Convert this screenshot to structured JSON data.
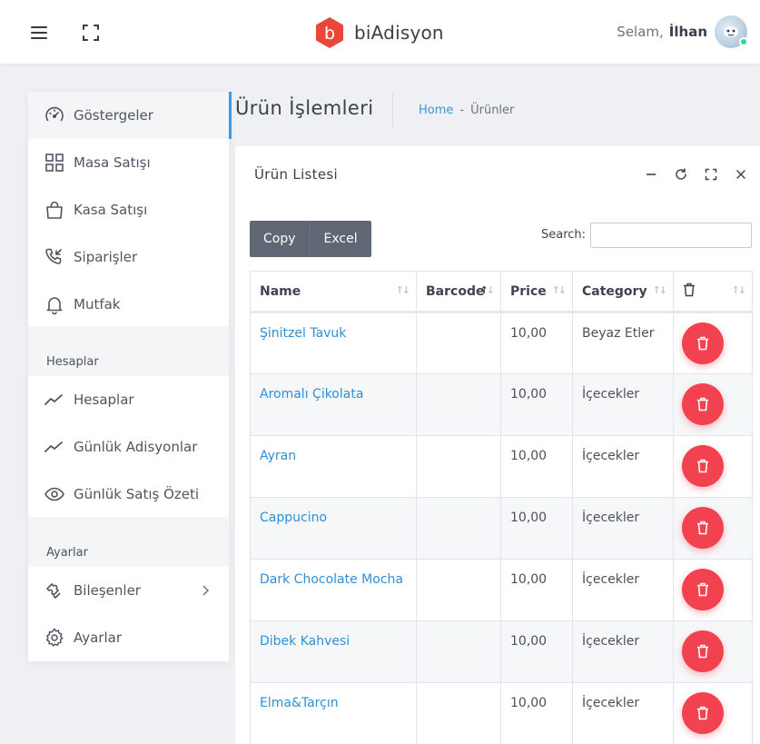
{
  "topbar": {
    "brand_letter": "b",
    "brand_name": "biAdisyon",
    "greeting": "Selam,",
    "username": "İlhan",
    "brand_color": "#e8473a"
  },
  "sidebar": {
    "items": [
      {
        "label": "Göstergeler",
        "icon": "speedometer-icon"
      },
      {
        "label": "Masa Satışı",
        "icon": "grid-icon"
      },
      {
        "label": "Kasa Satışı",
        "icon": "shopping-bag-icon"
      },
      {
        "label": "Siparişler",
        "icon": "phone-incoming-icon"
      },
      {
        "label": "Mutfak",
        "icon": "bell-icon"
      }
    ],
    "section_accounts": "Hesaplar",
    "accounts_items": [
      {
        "label": "Hesaplar",
        "icon": "trend-line-icon"
      },
      {
        "label": "Günlük Adisyonlar",
        "icon": "trend-line-icon"
      },
      {
        "label": "Günlük Satış Özeti",
        "icon": "eye-icon"
      }
    ],
    "section_settings": "Ayarlar",
    "settings_items": [
      {
        "label": "Bileşenler",
        "icon": "puzzle-icon"
      },
      {
        "label": "Ayarlar",
        "icon": "gear-icon"
      }
    ]
  },
  "page": {
    "title": "Ürün İşlemleri",
    "breadcrumb_home": "Home",
    "breadcrumb_sep": "-",
    "breadcrumb_current": "Ürünler"
  },
  "card": {
    "title": "Ürün Listesi",
    "copy_label": "Copy",
    "excel_label": "Excel",
    "search_label": "Search:",
    "search_value": ""
  },
  "table": {
    "headers": {
      "name": "Name",
      "barcode": "Barcode",
      "price": "Price",
      "category": "Category"
    },
    "rows": [
      {
        "name": "Şinitzel Tavuk",
        "barcode": "",
        "price": "10,00",
        "category": "Beyaz Etler"
      },
      {
        "name": "Aromalı Çikolata",
        "barcode": "",
        "price": "10,00",
        "category": "İçecekler"
      },
      {
        "name": "Ayran",
        "barcode": "",
        "price": "10,00",
        "category": "İçecekler"
      },
      {
        "name": "Cappucino",
        "barcode": "",
        "price": "10,00",
        "category": "İçecekler"
      },
      {
        "name": "Dark Chocolate Mocha",
        "barcode": "",
        "price": "10,00",
        "category": "İçecekler"
      },
      {
        "name": "Dibek Kahvesi",
        "barcode": "",
        "price": "10,00",
        "category": "İçecekler"
      },
      {
        "name": "Elma&Tarçın",
        "barcode": "",
        "price": "10,00",
        "category": "İçecekler"
      }
    ]
  },
  "colors": {
    "accent": "#3b9ae1",
    "link": "#2f8fd5",
    "delete": "#f3424f",
    "button_group": "#5f6775"
  }
}
